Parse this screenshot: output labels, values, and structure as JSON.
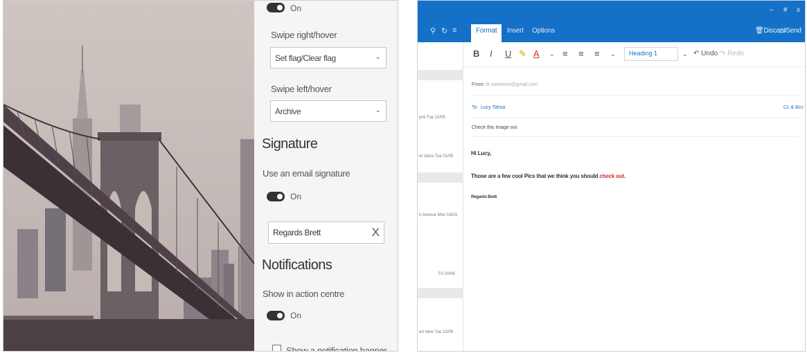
{
  "settings": {
    "top_toggle_label": "On",
    "swipe_right_label": "Swipe right/hover",
    "swipe_right_value": "Set flag/Clear flag",
    "swipe_left_label": "Swipe left/hover",
    "swipe_left_value": "Archive",
    "signature_heading": "Signature",
    "use_signature_label": "Use an email signature",
    "signature_toggle_label": "On",
    "signature_text": "Regards Brett",
    "clear_glyph": "X",
    "notifications_heading": "Notifications",
    "action_centre_label": "Show in action centre",
    "action_centre_toggle_label": "On",
    "banner_label": "Show a notification banner"
  },
  "mail": {
    "titlebar": {
      "minimize": "–",
      "maximize": "#",
      "close": "x"
    },
    "ribbon_tabs": [
      "Format",
      "Insert",
      "Options"
    ],
    "actions": {
      "discard": "Discard",
      "send": "Send"
    },
    "toolbar": {
      "bold": "B",
      "italic": "I",
      "underline": "U",
      "font_color": "A",
      "style_value": "Heading 1",
      "undo": "Undo",
      "redo": "Redo"
    },
    "list_items": [
      {
        "text": "ynk  Tue 12/05"
      },
      {
        "text": "et Jaina  Tue 01/05"
      },
      {
        "text": "h Avenue  Mon 16/03"
      },
      {
        "text": "Fri 20/06"
      },
      {
        "text": "ert New  Tue 22/06"
      }
    ],
    "from_label": "From:",
    "from_value": "dr.someone@gmail.com",
    "to_label": "To:",
    "to_value": "Lucy Tahsa",
    "cc_bcc": "Cc & Bcc",
    "subject": "Check this image out",
    "greeting": "Hi Lucy,",
    "body_text": "Those are a few cool Pics that we think you should ",
    "body_link": "check out.",
    "signature": "Regards Brett"
  },
  "colors": {
    "accent_blue": "#1570c8",
    "link_red": "#d12b2b",
    "toggle_dark": "#333333"
  }
}
